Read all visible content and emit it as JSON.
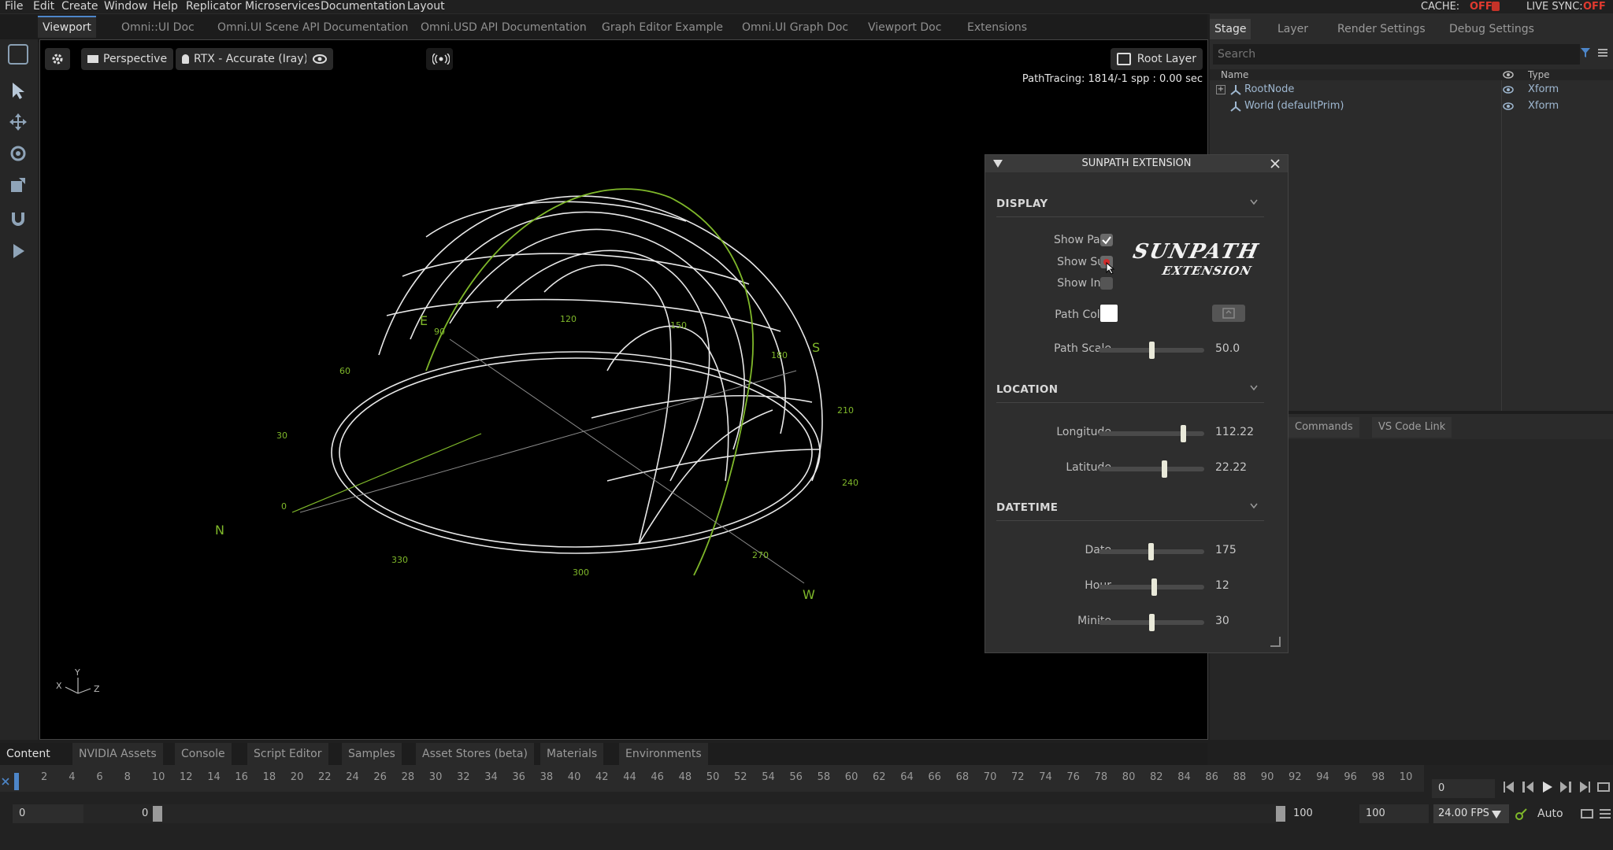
{
  "menu": {
    "items": [
      "File",
      "Edit",
      "Create",
      "Window",
      "Help",
      "Replicator",
      "Microservices",
      "Documentation",
      "Layout"
    ],
    "cache_label": "CACHE:",
    "cache_value": "OFF",
    "live_sync_label": "LIVE SYNC:",
    "live_sync_value": "OFF"
  },
  "tabs": [
    "Viewport",
    "Omni::UI Doc",
    "Omni.UI Scene API Documentation",
    "Omni.USD API Documentation",
    "Graph Editor Example",
    "Omni.UI Graph Doc",
    "Viewport Doc",
    "Extensions"
  ],
  "viewport": {
    "camera_label": "Perspective",
    "renderer_label": "RTX - Accurate (Iray)",
    "root_layer_label": "Root Layer",
    "path_tracing": "PathTracing: 1814/-1 spp : 0.00 sec",
    "compass": {
      "N": "N",
      "E": "E",
      "S": "S",
      "W": "W"
    },
    "degree_labels": [
      "0",
      "30",
      "60",
      "90",
      "120",
      "150",
      "180",
      "210",
      "240",
      "270",
      "300",
      "330"
    ],
    "axis_labels": {
      "x": "X",
      "y": "Y",
      "z": "Z"
    }
  },
  "right_panel": {
    "tabs": [
      "Stage",
      "Layer",
      "Render Settings",
      "Debug Settings"
    ],
    "search_placeholder": "Search",
    "columns": {
      "name": "Name",
      "type": "Type"
    },
    "rows": [
      {
        "name": "RootNode",
        "type": "Xform"
      },
      {
        "name": "World (defaultPrim)",
        "type": "Xform"
      }
    ],
    "lower_tabs": [
      "Commands",
      "VS Code Link"
    ]
  },
  "sunpath": {
    "title": "SUNPATH EXTENSION",
    "logo_line1": "SUNPATH",
    "logo_line2": "EXTENSION",
    "display": {
      "section": "DISPLAY",
      "show_path": "Show Path",
      "show_path_checked": true,
      "show_sun": "Show Sun",
      "show_sun_checked": false,
      "show_info": "Show Info",
      "show_info_checked": false,
      "path_color_label": "Path Color",
      "path_color": "#ffffff",
      "path_scale_label": "Path Scale",
      "path_scale": "50.0",
      "path_scale_frac": 0.5
    },
    "location": {
      "section": "LOCATION",
      "longitude_label": "Longitude",
      "longitude": "112.22",
      "longitude_frac": 0.8,
      "latitude_label": "Latitude",
      "latitude": "22.22",
      "latitude_frac": 0.62
    },
    "datetime": {
      "section": "DATETIME",
      "date_label": "Date",
      "date": "175",
      "date_frac": 0.49,
      "hour_label": "Hour",
      "hour": "12",
      "hour_frac": 0.52,
      "minite_label": "Minite",
      "minite": "30",
      "minite_frac": 0.5
    }
  },
  "bottom": {
    "tabs": [
      "Content",
      "NVIDIA Assets",
      "Console",
      "Script Editor",
      "Samples",
      "Asset Stores (beta)",
      "Materials",
      "Environments"
    ],
    "timeline_ticks": [
      "2",
      "4",
      "6",
      "8",
      "10",
      "12",
      "14",
      "16",
      "18",
      "20",
      "22",
      "24",
      "26",
      "28",
      "30",
      "32",
      "34",
      "36",
      "38",
      "40",
      "42",
      "44",
      "46",
      "48",
      "50",
      "52",
      "54",
      "56",
      "58",
      "60",
      "62",
      "64",
      "66",
      "68",
      "70",
      "72",
      "74",
      "76",
      "78",
      "80",
      "82",
      "84",
      "86",
      "88",
      "90",
      "92",
      "94",
      "96",
      "98",
      "10"
    ],
    "current_frame": "0",
    "start_field": "0",
    "start_value": "0",
    "end_value": "100",
    "end_field": "100",
    "fps": "24.00 FPS",
    "auto_label": "Auto"
  },
  "colors": {
    "accent": "#4d86c9",
    "sun_green": "#7fb82a",
    "off_red": "#e03a2f"
  }
}
